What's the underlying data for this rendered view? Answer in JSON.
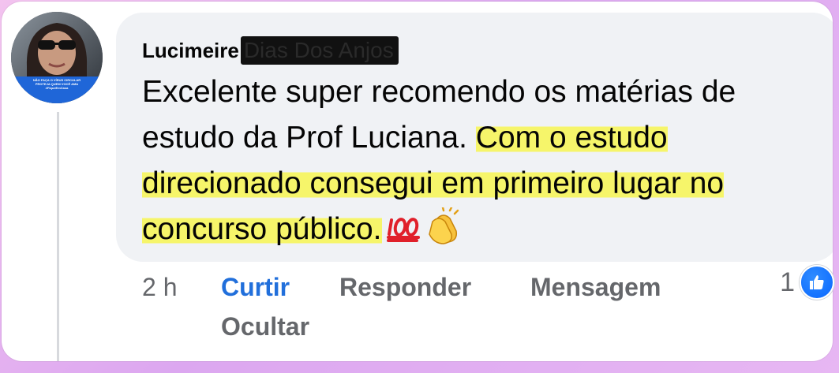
{
  "comment": {
    "author": "Lucimeire",
    "author_redacted": "Dias Dos Anjos",
    "text_plain": "Excelente super recomendo os matérias de estudo da Prof Luciana. ",
    "text_highlighted": "Com o estudo direcionado consegui em primeiro lugar no concurso público.",
    "emoji": [
      "hundred-points",
      "clapping-hands"
    ]
  },
  "avatar": {
    "caption": "NÃO FAÇA O VÍRUS CIRCULAR PROTEJA QUEM VOCÊ AMA #FiqueEmCasa"
  },
  "actions": {
    "time": "2 h",
    "like": "Curtir",
    "reply": "Responder",
    "message": "Mensagem",
    "hide": "Ocultar"
  },
  "reactions": {
    "count": "1",
    "type": "like-icon"
  },
  "colors": {
    "highlight": "#f6f56a",
    "like_blue": "#216fdb",
    "bubble": "#f0f2f5",
    "background": "#dca7f0"
  }
}
